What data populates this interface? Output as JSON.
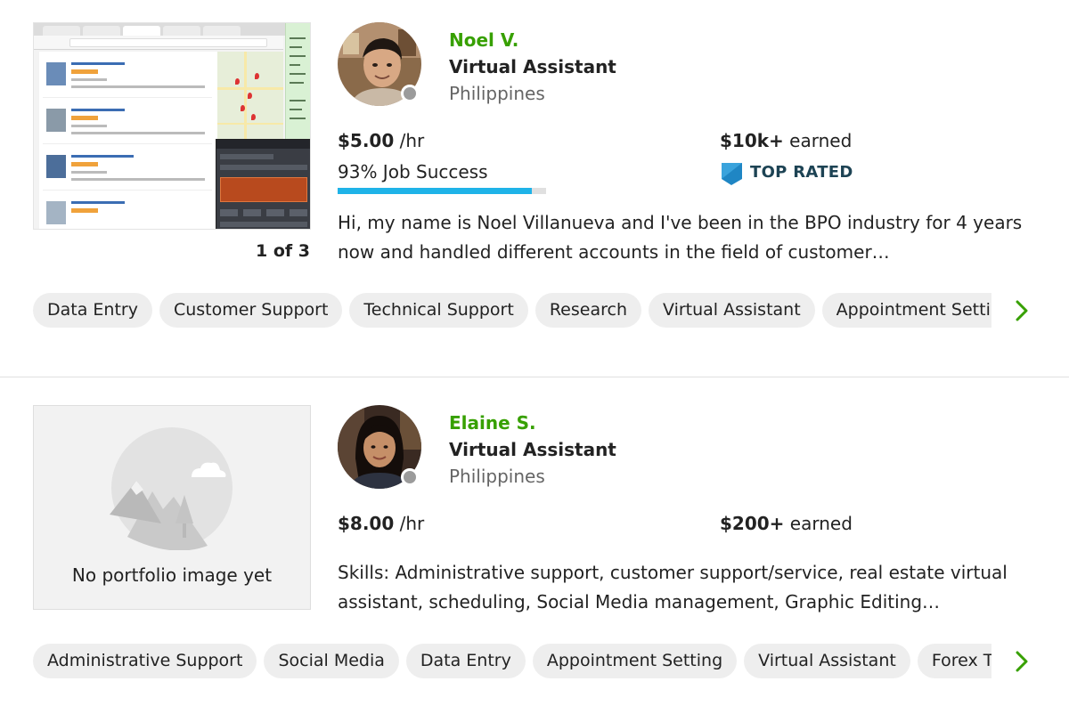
{
  "freelancers": [
    {
      "name": "Noel V.",
      "title": "Virtual Assistant",
      "location": "Philippines",
      "rate_amount": "$5.00",
      "rate_unit": "/hr",
      "earned_amount": "$10k+",
      "earned_label": "earned",
      "job_success": "93% Job Success",
      "job_success_percent": 93,
      "badge": "TOP RATED",
      "portfolio_counter": "1 of 3",
      "description": "Hi, my name is Noel Villanueva and I've been in the BPO industry for 4 years now and handled different accounts in the field of customer…",
      "skills": [
        "Data Entry",
        "Customer Support",
        "Technical Support",
        "Research",
        "Virtual Assistant",
        "Appointment Setting"
      ]
    },
    {
      "name": "Elaine S.",
      "title": "Virtual Assistant",
      "location": "Philippines",
      "rate_amount": "$8.00",
      "rate_unit": "/hr",
      "earned_amount": "$200+",
      "earned_label": "earned",
      "portfolio_empty_text": "No portfolio image yet",
      "description": "Skills: Administrative support, customer support/service, real estate virtual assistant, scheduling, Social Media management, Graphic Editing…",
      "skills": [
        "Administrative Support",
        "Social Media",
        "Data Entry",
        "Appointment Setting",
        "Virtual Assistant",
        "Forex Trading"
      ]
    }
  ],
  "icons": {
    "status": "status-offline-icon",
    "badge": "top-rated-badge-icon",
    "next": "chevron-right-icon",
    "empty_portfolio": "empty-portfolio-icon"
  },
  "colors": {
    "name": "#37a000",
    "accent_green": "#37a000",
    "success_bar": "#1fb3e8",
    "badge_blue": "#1d4354",
    "pill_bg": "#eeeeee",
    "status_dot": "#9b9b9b"
  }
}
